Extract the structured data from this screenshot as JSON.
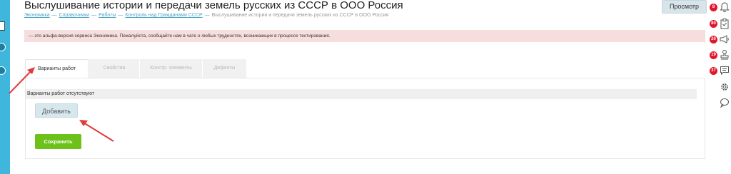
{
  "header": {
    "title": "Выслушивание истории и передачи земель русских из СССР в ООО Россия",
    "preview_label": "Просмотр"
  },
  "breadcrumb": {
    "items": [
      "Экономика",
      "Справочники",
      "Работы",
      "Контроль над Гражданами СССР"
    ],
    "separator": "—",
    "current": "Выслушивание истории и передачи земель русских из СССР в ООО Россия"
  },
  "notice": {
    "text": "— это альфа-версия сервиса Экономика. Пожалуйста, сообщайте нам в чате о любых трудностях, возникающих в процессе тестирования."
  },
  "tabs": [
    {
      "label": "Варианты работ",
      "active": true
    },
    {
      "label": "Свойства",
      "active": false
    },
    {
      "label": "Констр. элементы",
      "active": false
    },
    {
      "label": "Дефекты",
      "active": false
    }
  ],
  "panel": {
    "empty_text": "Варианты работ отсутствуют",
    "add_label": "Добавить",
    "save_label": "Сохранить"
  },
  "sidebar": {
    "items": [
      {
        "badge": "8",
        "icon": "bell-icon"
      },
      {
        "badge": "80",
        "icon": "clipboard-icon"
      },
      {
        "badge": "20",
        "icon": "megaphone-icon"
      },
      {
        "badge": "19",
        "icon": "stamp-icon"
      },
      {
        "badge": "37",
        "icon": "chat-icon"
      },
      {
        "badge": "",
        "icon": "gear-icon"
      },
      {
        "badge": "",
        "icon": "support-chat-icon"
      }
    ]
  },
  "colors": {
    "accent": "#3fb7dc",
    "save": "#6cc219",
    "badge": "#e3162b",
    "notice_bg": "#f6dede",
    "annotation_arrow": "#e03a3a"
  }
}
